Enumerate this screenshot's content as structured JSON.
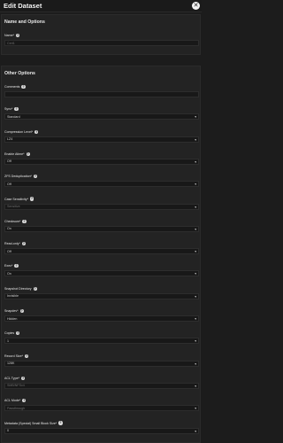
{
  "header": {
    "title": "Edit Dataset",
    "close_icon": "close-icon"
  },
  "name_section": {
    "title": "Name and Options",
    "name": {
      "label": "Name*",
      "value": "Cert1"
    }
  },
  "other_section": {
    "title": "Other Options",
    "fields": [
      {
        "key": "comments",
        "label": "Comments",
        "value": "",
        "type": "input",
        "muted": false
      },
      {
        "key": "sync",
        "label": "Sync*",
        "value": "Standard",
        "type": "select",
        "muted": false
      },
      {
        "key": "compression",
        "label": "Compression Level*",
        "value": "LZ4",
        "type": "select",
        "muted": false
      },
      {
        "key": "atime",
        "label": "Enable Atime*",
        "value": "Off",
        "type": "select",
        "muted": false
      },
      {
        "key": "dedup",
        "label": "ZFS Deduplication*",
        "value": "Off",
        "type": "select",
        "muted": false
      },
      {
        "key": "case",
        "label": "Case Sensitivity*",
        "value": "Sensitive",
        "type": "select",
        "muted": true
      },
      {
        "key": "checksum",
        "label": "Checksum*",
        "value": "On",
        "type": "select",
        "muted": false
      },
      {
        "key": "readonly",
        "label": "Read-only*",
        "value": "Off",
        "type": "select",
        "muted": false
      },
      {
        "key": "exec",
        "label": "Exec*",
        "value": "On",
        "type": "select",
        "muted": false
      },
      {
        "key": "snapdir",
        "label": "Snapshot Directory",
        "value": "Invisible",
        "type": "select",
        "muted": false
      },
      {
        "key": "snapdev",
        "label": "Snapdev*",
        "value": "Hidden",
        "type": "select",
        "muted": false
      },
      {
        "key": "copies",
        "label": "Copies",
        "value": "1",
        "type": "select",
        "muted": false
      },
      {
        "key": "recordsize",
        "label": "Record Size*",
        "value": "128K",
        "type": "select",
        "muted": false
      },
      {
        "key": "acltype",
        "label": "ACL Type*",
        "value": "SMB/NFSv4",
        "type": "select",
        "muted": true
      },
      {
        "key": "aclmode",
        "label": "ACL Mode*",
        "value": "Passthrough",
        "type": "select",
        "muted": true
      },
      {
        "key": "smallblock",
        "label": "Metadata (Special) Small Block Size*",
        "value": "0",
        "type": "select",
        "muted": false
      }
    ]
  }
}
